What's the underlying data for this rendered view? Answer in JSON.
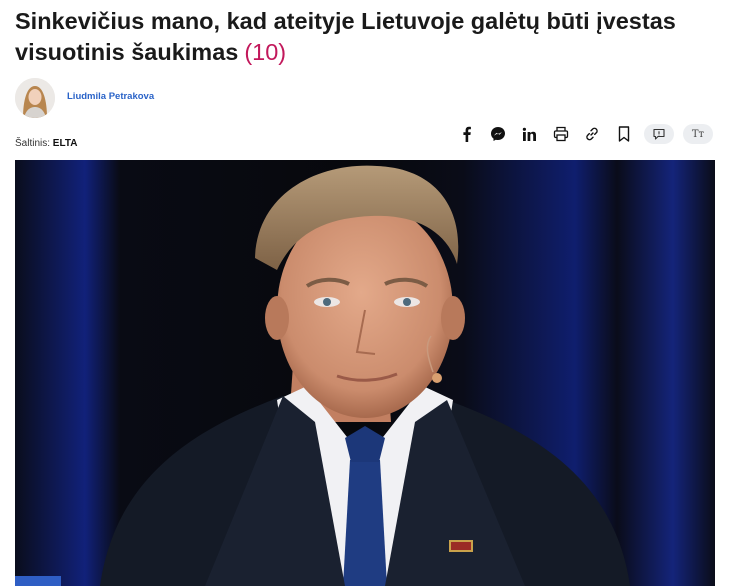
{
  "article": {
    "title": "Sinkevičius mano, kad ateityje Lietuvoje galėtų būti įvestas visuotinis šaukimas",
    "comment_count": "(10)",
    "author_name": "Liudmila Petrakova",
    "source_label": "Šaltinis:",
    "source_name": "ELTA",
    "text_size_label": "Tт"
  },
  "share_icons": [
    "facebook-icon",
    "messenger-icon",
    "linkedin-icon",
    "print-icon",
    "link-icon",
    "bookmark-icon",
    "comments-icon",
    "text-size-icon"
  ],
  "colors": {
    "title": "#1a1a1a",
    "comment_count": "#c2185b",
    "author": "#2a63c8",
    "photo_bg": "#08090e",
    "accent_blue": "#2f5ec4"
  }
}
